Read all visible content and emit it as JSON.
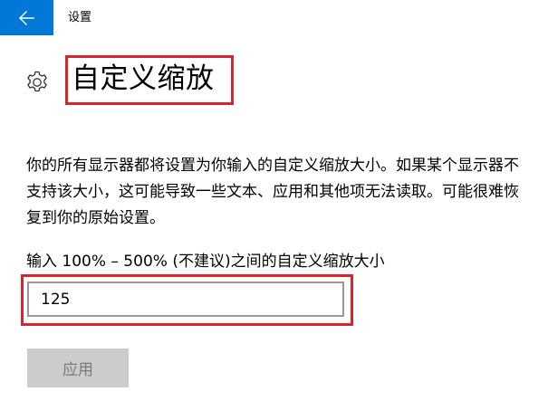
{
  "header": {
    "window_title": "设置"
  },
  "page": {
    "title": "自定义缩放",
    "description": "你的所有显示器都将设置为你输入的自定义缩放大小。如果某个显示器不支持该大小，这可能导致一些文本、应用和其他项无法读取。可能很难恢复到你的原始设置。"
  },
  "scale": {
    "label": "输入 100% – 500% (不建议)之间的自定义缩放大小",
    "value": "125"
  },
  "actions": {
    "apply_label": "应用"
  },
  "icons": {
    "back": "back-arrow-icon",
    "settings": "gear-icon"
  },
  "colors": {
    "accent": "#0078d7",
    "highlight": "#d9262e",
    "disabled_button": "#cccccc",
    "disabled_text": "#7a7a7a"
  }
}
